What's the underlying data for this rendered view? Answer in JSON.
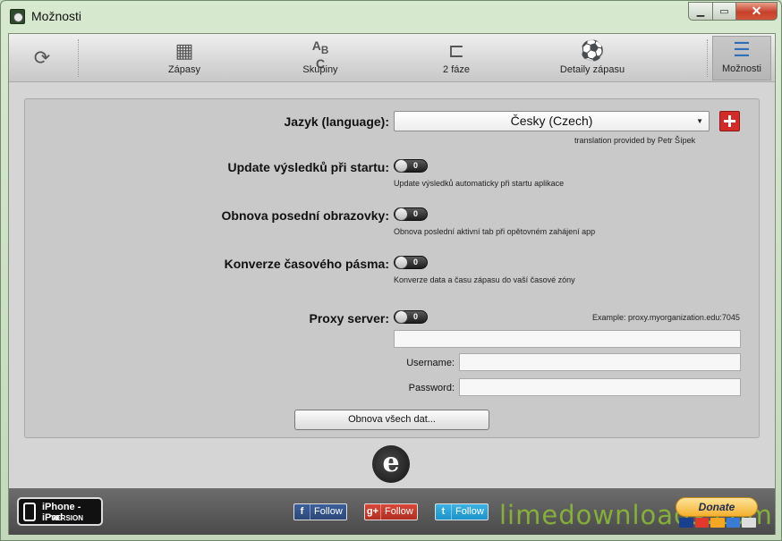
{
  "window": {
    "title": "Možnosti",
    "min_icon": "minimize-icon",
    "max_icon": "maximize-icon",
    "close_icon": "close-icon"
  },
  "toolbar": {
    "refresh_icon": "refresh-icon",
    "items": [
      {
        "label": "Zápasy",
        "icon": "calendar-icon"
      },
      {
        "label": "Skupiny",
        "icon": "abc-groups-icon"
      },
      {
        "label": "2 fáze",
        "icon": "bracket-icon"
      },
      {
        "label": "Detaily zápasu",
        "icon": "soccer-ball-icon"
      },
      {
        "label": "Možnosti",
        "icon": "list-icon",
        "active": true
      }
    ]
  },
  "settings": {
    "language": {
      "label": "Jazyk (language):",
      "value": "Česky (Czech)",
      "credit": "translation provided by Petr Šípek"
    },
    "update_on_start": {
      "label": "Update výsledků při startu:",
      "toggle": "0",
      "description": "Update výsledků automaticky při startu aplikace"
    },
    "restore_screen": {
      "label": "Obnova posední obrazovky:",
      "toggle": "0",
      "description": "Obnova poslední aktivní tab při opětovném zahájení app"
    },
    "timezone": {
      "label": "Konverze časového pásma:",
      "toggle": "0",
      "description": "Konverze data a času zápasu do vaší časové zóny"
    },
    "proxy": {
      "label": "Proxy server:",
      "toggle": "0",
      "example": "Example: proxy.myorganization.edu:7045",
      "server_value": "",
      "username_label": "Username:",
      "username_value": "",
      "password_label": "Password:",
      "password_value": ""
    },
    "refresh_all_button": "Obnova všech dat..."
  },
  "footer": {
    "badge_line1": "iPhone - iPad",
    "badge_line2": "VERSION",
    "facebook": {
      "icon_text": "f",
      "label": "Follow"
    },
    "googleplus": {
      "icon_text": "g+",
      "label": "Follow"
    },
    "twitter": {
      "icon_text": "t",
      "label": "Follow"
    },
    "watermark": "limedownloads.com",
    "donate_label": "Donate"
  },
  "colors": {
    "flag_red": "#d32b27",
    "watermark_green": "#8dbf34",
    "donate_gold": "#f4b02e"
  }
}
